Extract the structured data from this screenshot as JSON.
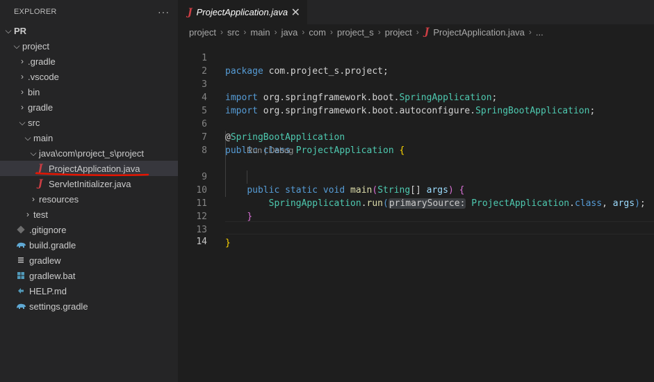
{
  "sidebar": {
    "title": "EXPLORER",
    "more": "···",
    "root": "PR",
    "items": [
      {
        "label": "project"
      },
      {
        "label": ".gradle"
      },
      {
        "label": ".vscode"
      },
      {
        "label": "bin"
      },
      {
        "label": "gradle"
      },
      {
        "label": "src"
      },
      {
        "label": "main"
      },
      {
        "label": "java\\com\\project_s\\project"
      },
      {
        "label": "ProjectApplication.java"
      },
      {
        "label": "ServletInitializer.java"
      },
      {
        "label": "resources"
      },
      {
        "label": "test"
      },
      {
        "label": ".gitignore"
      },
      {
        "label": "build.gradle"
      },
      {
        "label": "gradlew"
      },
      {
        "label": "gradlew.bat"
      },
      {
        "label": "HELP.md"
      },
      {
        "label": "settings.gradle"
      }
    ]
  },
  "tab": {
    "label": "ProjectApplication.java",
    "close": "✕",
    "icon": "J"
  },
  "breadcrumb": {
    "parts": [
      "project",
      "src",
      "main",
      "java",
      "com",
      "project_s",
      "project"
    ],
    "file": "ProjectApplication.java",
    "tail": "..."
  },
  "editor": {
    "line_numbers": [
      "1",
      "2",
      "3",
      "4",
      "5",
      "6",
      "7",
      "8",
      "9",
      "10",
      "11",
      "12",
      "13",
      "14"
    ],
    "codelens": "Run | Debug",
    "tokens": {
      "l1_kw": "package",
      "l1_pkg": " com.project_s.project;",
      "import": "import",
      "l3_a": "org",
      "l3_b": "springframework",
      "l3_c": "boot",
      "l3_d": "SpringApplication",
      "l4_a": "org",
      "l4_b": "springframework",
      "l4_c": "boot",
      "l4_d": "autoconfigure",
      "l4_e": "SpringBootApplication",
      "at": "@",
      "anno": "SpringBootApplication",
      "public": "public",
      "class": "class",
      "cls_name": "ProjectApplication",
      "static": "static",
      "void": "void",
      "main": "main",
      "string": "String",
      "args": "args",
      "sa": "SpringApplication",
      "run": "run",
      "hint": "primarySource:",
      "pa": "ProjectApplication",
      "class_kw": "class"
    }
  },
  "colors": {
    "annotation_underline": "#e51400",
    "selected_row": "#37373d",
    "java_icon": "#cc3e44"
  }
}
